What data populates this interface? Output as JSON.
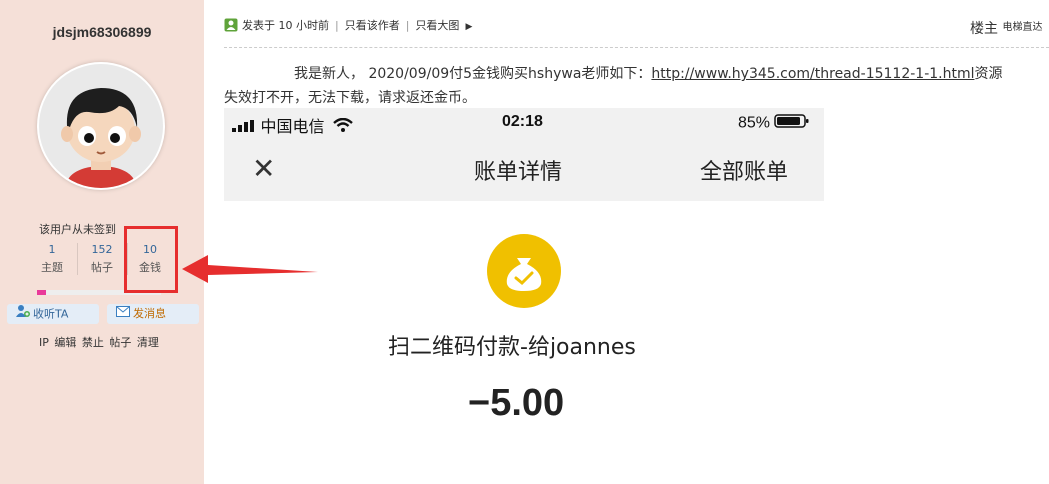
{
  "user": {
    "username": "jdsjm68306899",
    "checkin": "该用户从未签到",
    "stats": [
      {
        "value": "1",
        "label": "主题"
      },
      {
        "value": "152",
        "label": "帖子"
      },
      {
        "value": "10",
        "label": "金钱"
      }
    ],
    "progress": 0.07,
    "follow_label": "收听TA",
    "message_label": "发消息",
    "admin_links": [
      "IP",
      "编辑",
      "禁止",
      "帖子",
      "清理"
    ]
  },
  "post": {
    "posted": "发表于 10 小时前",
    "only_author": "只看该作者",
    "only_big_images": "只看大图",
    "floor": "楼主",
    "floor_extra": "电梯直达",
    "text_before": "我是新人， 2020/09/09付5金钱购买hshywa老师如下：",
    "link": "http://www.hy345.com/thread-15112-1-1.html",
    "text_after": "资源",
    "line2": "失效打不开，无法下载，请求返还金币。"
  },
  "screenshot": {
    "carrier": "中国电信",
    "time": "02:18",
    "battery": "85%",
    "title": "账单详情",
    "all_bills": "全部账单",
    "pay_title": "扫二维码付款-给joannes",
    "amount": "−5.00"
  },
  "colors": {
    "sidebar_bg": "#f5e0d8",
    "highlight": "#e62e2e",
    "link": "#336699",
    "bag": "#f0c000"
  },
  "icons": {
    "close": "close-icon",
    "signal": "signal-icon",
    "wifi": "wifi-icon",
    "battery": "battery-icon"
  }
}
